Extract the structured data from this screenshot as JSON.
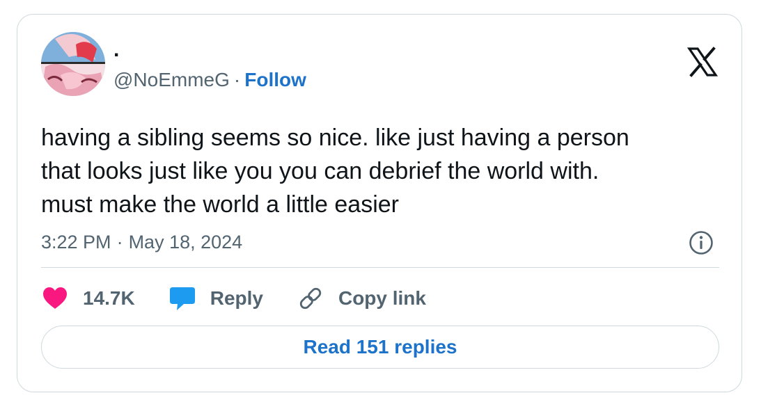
{
  "author": {
    "display_name": ".",
    "handle": "@NoEmmeG",
    "separator": "·",
    "follow_label": "Follow"
  },
  "tweet": {
    "text": "having a sibling seems so nice. like just having a person\nthat looks just like you you can debrief the world with.\nmust make the world a little easier",
    "time": "3:22 PM",
    "separator": "·",
    "date": "May 18, 2024"
  },
  "actions": {
    "likes_count": "14.7K",
    "reply_label": "Reply",
    "copy_link_label": "Copy link"
  },
  "read_replies_label": "Read 151 replies",
  "icons": {
    "logo": "x-logo-icon",
    "info": "info-icon",
    "like": "heart-icon",
    "reply": "speech-bubble-icon",
    "copy": "link-icon"
  },
  "colors": {
    "heart": "#f91880",
    "reply_bubble": "#1d9bf0",
    "link_blue": "#1d72c9",
    "secondary_text": "#536471",
    "border": "#cfd9de"
  }
}
